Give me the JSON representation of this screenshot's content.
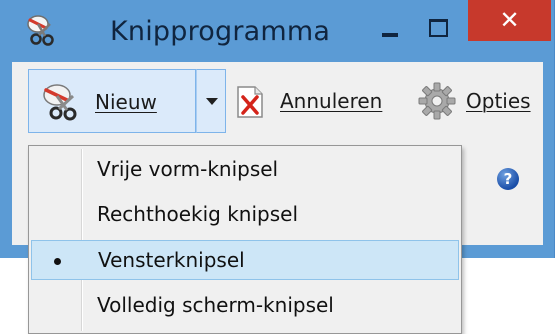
{
  "window": {
    "title": "Knipprogramma",
    "close_glyph": "✕"
  },
  "toolbar": {
    "new_label": "Nieuw",
    "cancel_label": "Annuleren",
    "options_label": "Opties",
    "help_glyph": "?"
  },
  "menu": {
    "items": [
      {
        "label": "Vrije vorm-knipsel",
        "selected": false
      },
      {
        "label": "Rechthoekig knipsel",
        "selected": false
      },
      {
        "label": "Vensterknipsel",
        "selected": true
      },
      {
        "label": "Volledig scherm-knipsel",
        "selected": false
      }
    ]
  },
  "colors": {
    "titlebar": "#5b9bd5",
    "close_button": "#c7392c",
    "menu_highlight": "#cde6f7"
  }
}
